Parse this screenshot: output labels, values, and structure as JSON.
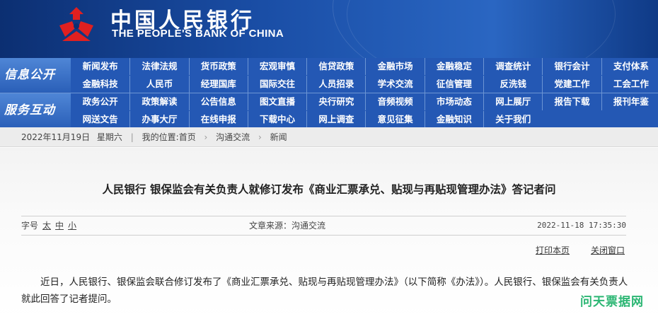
{
  "header": {
    "bank_name_cn": "中国人民银行",
    "bank_name_en": "THE PEOPLE'S BANK OF CHINA",
    "logo": "pboc-emblem-icon",
    "colors": {
      "banner": "#1a4ea6",
      "emblem": "#e02020"
    }
  },
  "nav": {
    "groups": [
      {
        "title": "信息公开",
        "rows": [
          [
            "新闻发布",
            "法律法规",
            "货币政策",
            "宏观审慎",
            "信贷政策",
            "金融市场",
            "金融稳定",
            "调查统计",
            "银行会计",
            "支付体系"
          ],
          [
            "金融科技",
            "人民币",
            "经理国库",
            "国际交往",
            "人员招录",
            "学术交流",
            "征信管理",
            "反洗钱",
            "党建工作",
            "工会工作"
          ]
        ]
      },
      {
        "title": "服务互动",
        "rows": [
          [
            "政务公开",
            "政策解读",
            "公告信息",
            "图文直播",
            "央行研究",
            "音频视频",
            "市场动态",
            "网上展厅",
            "报告下载",
            "报刊年鉴"
          ],
          [
            "网送文告",
            "办事大厅",
            "在线申报",
            "下载中心",
            "网上调查",
            "意见征集",
            "金融知识",
            "关于我们"
          ]
        ]
      }
    ]
  },
  "breadcrumb": {
    "date": "2022年11月19日",
    "weekday": "星期六",
    "location_label": "我的位置:",
    "home": "首页",
    "level1": "沟通交流",
    "level2": "新闻"
  },
  "article": {
    "title": "人民银行 银保监会有关负责人就修订发布《商业汇票承兑、贴现与再贴现管理办法》答记者问",
    "font_size_label": "字号",
    "font_sizes": [
      "太",
      "中",
      "小"
    ],
    "source": "文章来源：沟通交流",
    "date": "2022-11-18 17:35:30",
    "print_label": "打印本页",
    "close_label": "关闭窗口",
    "body": "近日，人民银行、银保监会联合修订发布了《商业汇票承兑、贴现与再贴现管理办法》（以下简称《办法》）。人民银行、银保监会有关负责人就此回答了记者提问。"
  },
  "watermark": "问天票据网"
}
